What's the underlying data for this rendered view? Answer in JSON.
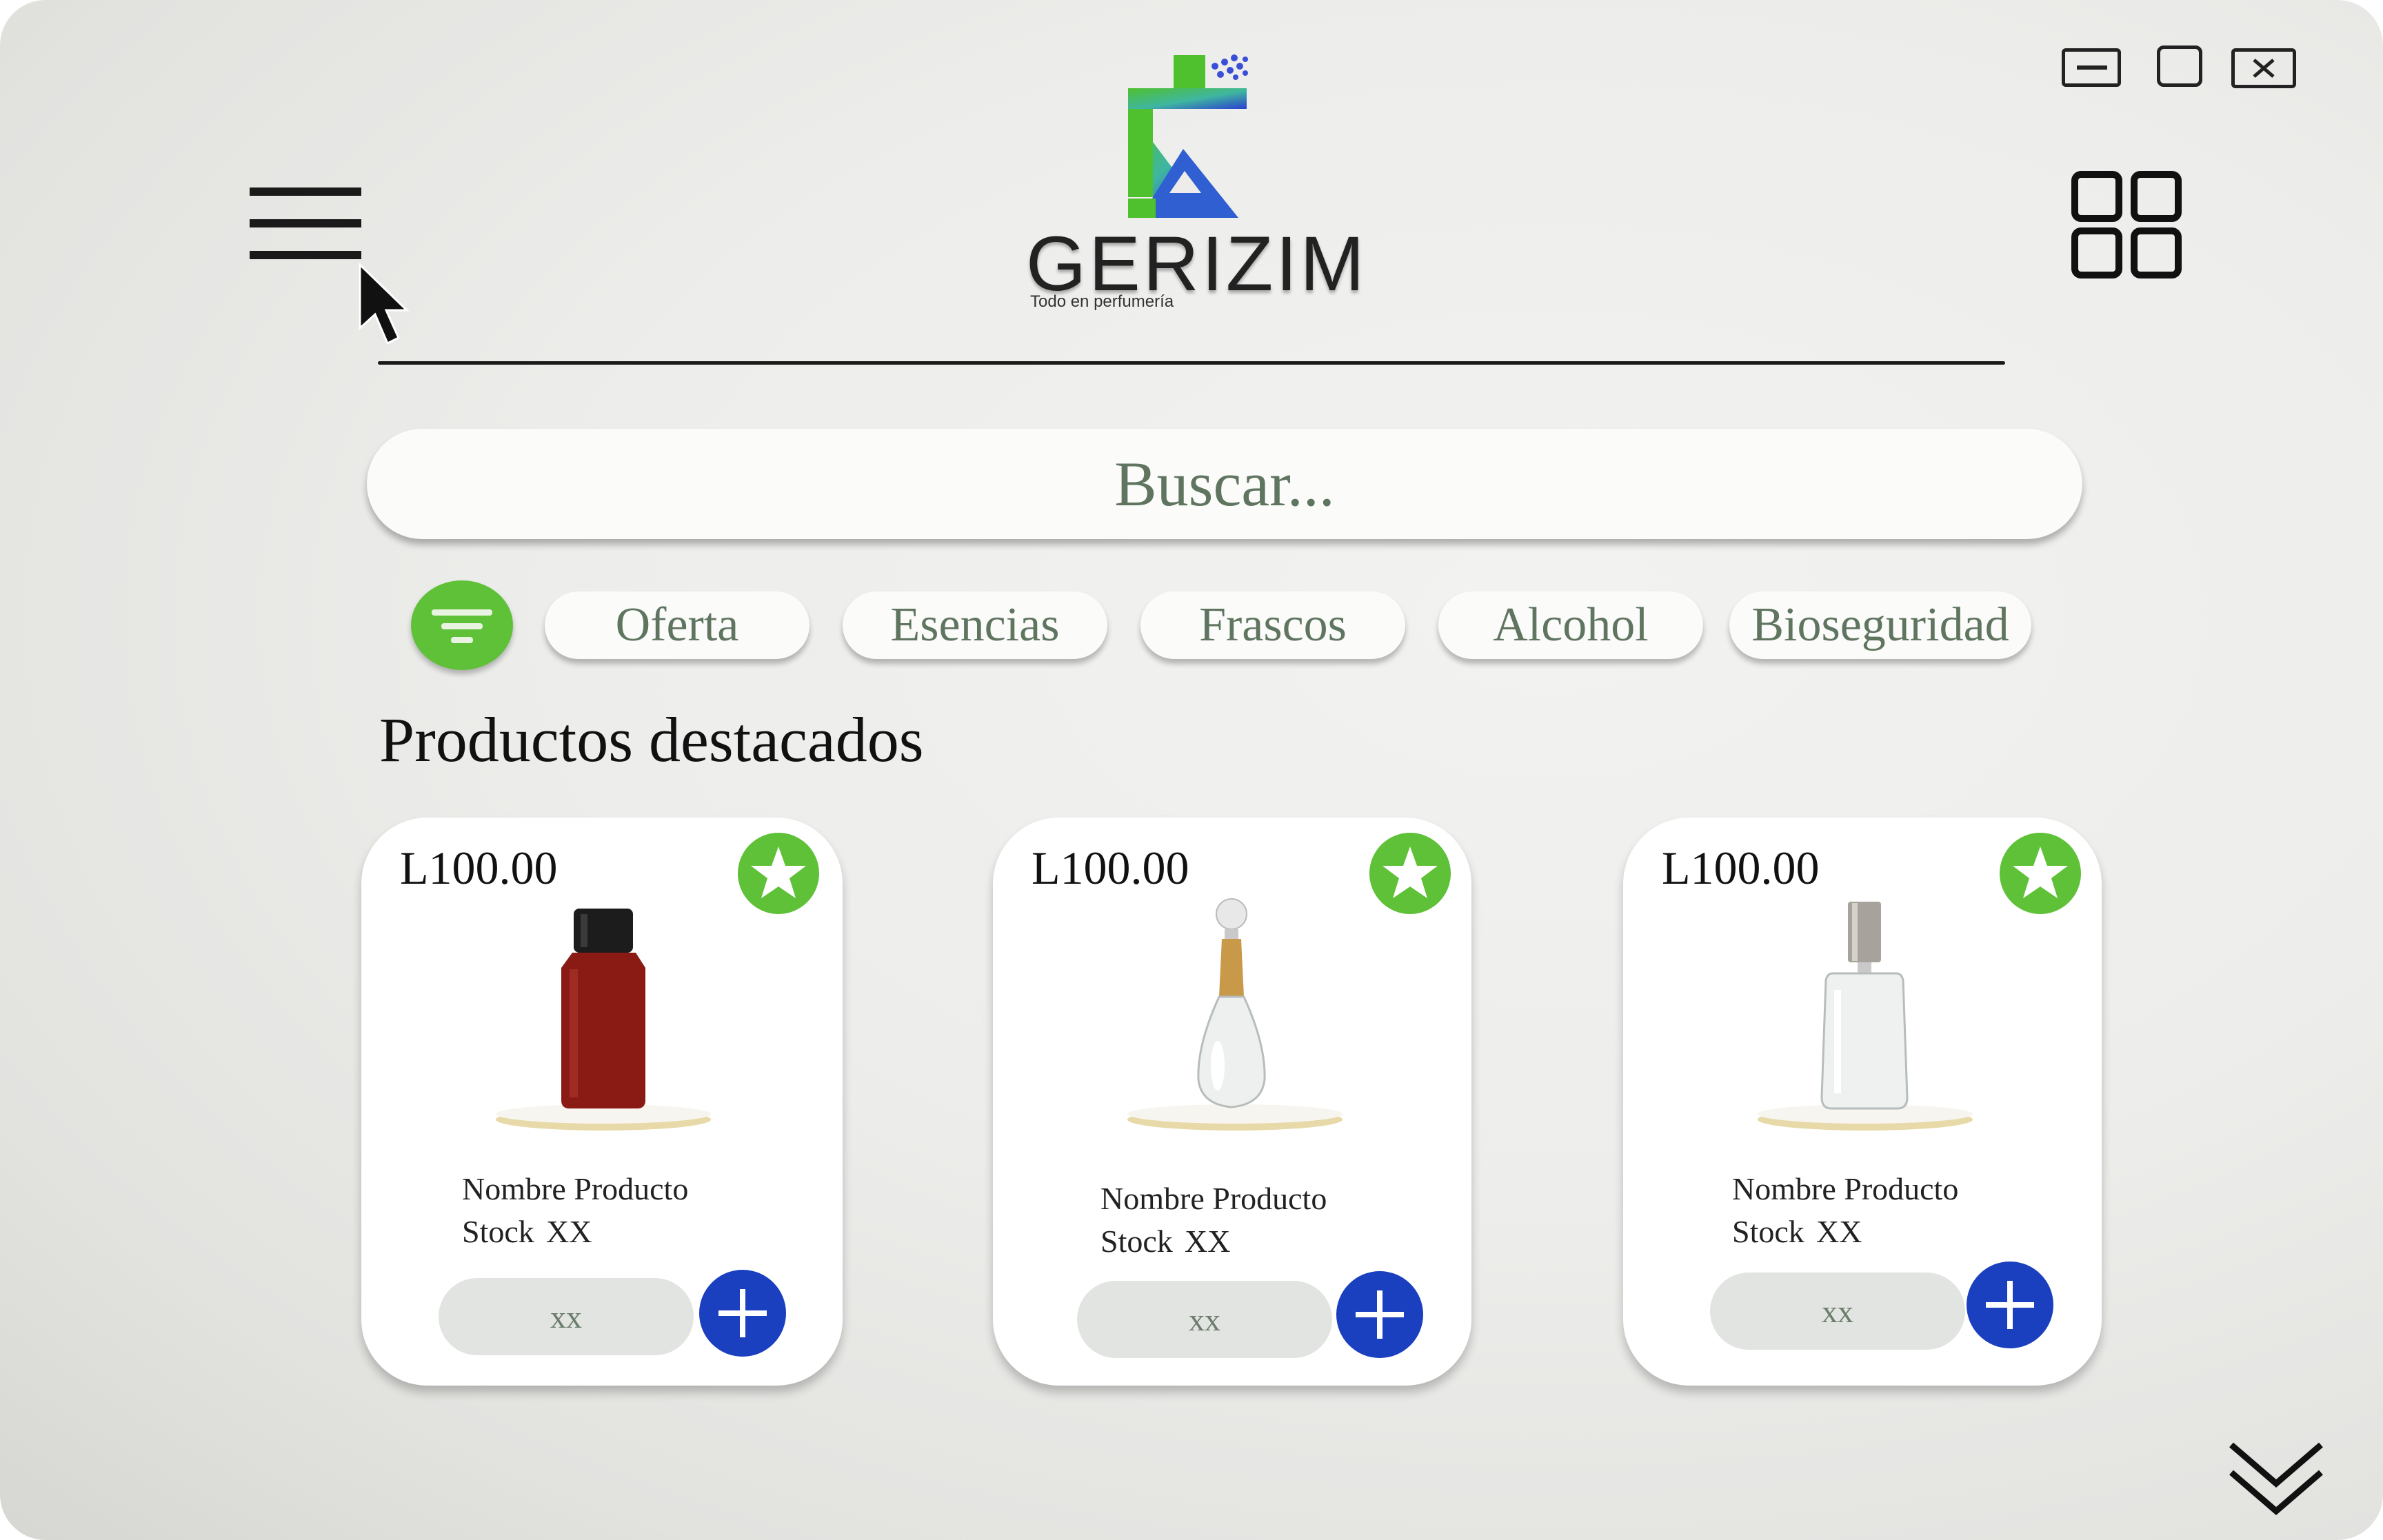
{
  "brand": {
    "name": "GERIZIM",
    "tagline": "Todo en perfumería"
  },
  "window_controls": {
    "minimize_icon": "minimize-icon",
    "maximize_icon": "maximize-icon",
    "close_icon": "close-icon"
  },
  "header": {
    "menu_icon": "hamburger-menu-icon",
    "grid_icon": "grid-view-icon"
  },
  "search": {
    "placeholder": "Buscar..."
  },
  "filters": {
    "filter_icon": "filter-icon",
    "chips": [
      {
        "label": "Oferta"
      },
      {
        "label": "Esencias"
      },
      {
        "label": "Frascos"
      },
      {
        "label": "Alcohol"
      },
      {
        "label": "Bioseguridad"
      }
    ]
  },
  "featured": {
    "title": "Productos destacados",
    "products": [
      {
        "price": "L100.00",
        "name": "Nombre Producto",
        "stock_label": "Stock",
        "stock_value": "XX",
        "quantity": "xx",
        "image": "red-square-perfume-bottle"
      },
      {
        "price": "L100.00",
        "name": "Nombre Producto",
        "stock_label": "Stock",
        "stock_value": "XX",
        "quantity": "xx",
        "image": "clear-drop-perfume-bottle"
      },
      {
        "price": "L100.00",
        "name": "Nombre Producto",
        "stock_label": "Stock",
        "stock_value": "XX",
        "quantity": "xx",
        "image": "clear-rectangular-spray-bottle"
      }
    ]
  },
  "scroll_down_icon": "double-chevron-down-icon",
  "colors": {
    "accent_green": "#5fc137",
    "add_button_blue": "#1a3fbf",
    "chip_text": "#5f7560",
    "background": "#ededeb"
  }
}
